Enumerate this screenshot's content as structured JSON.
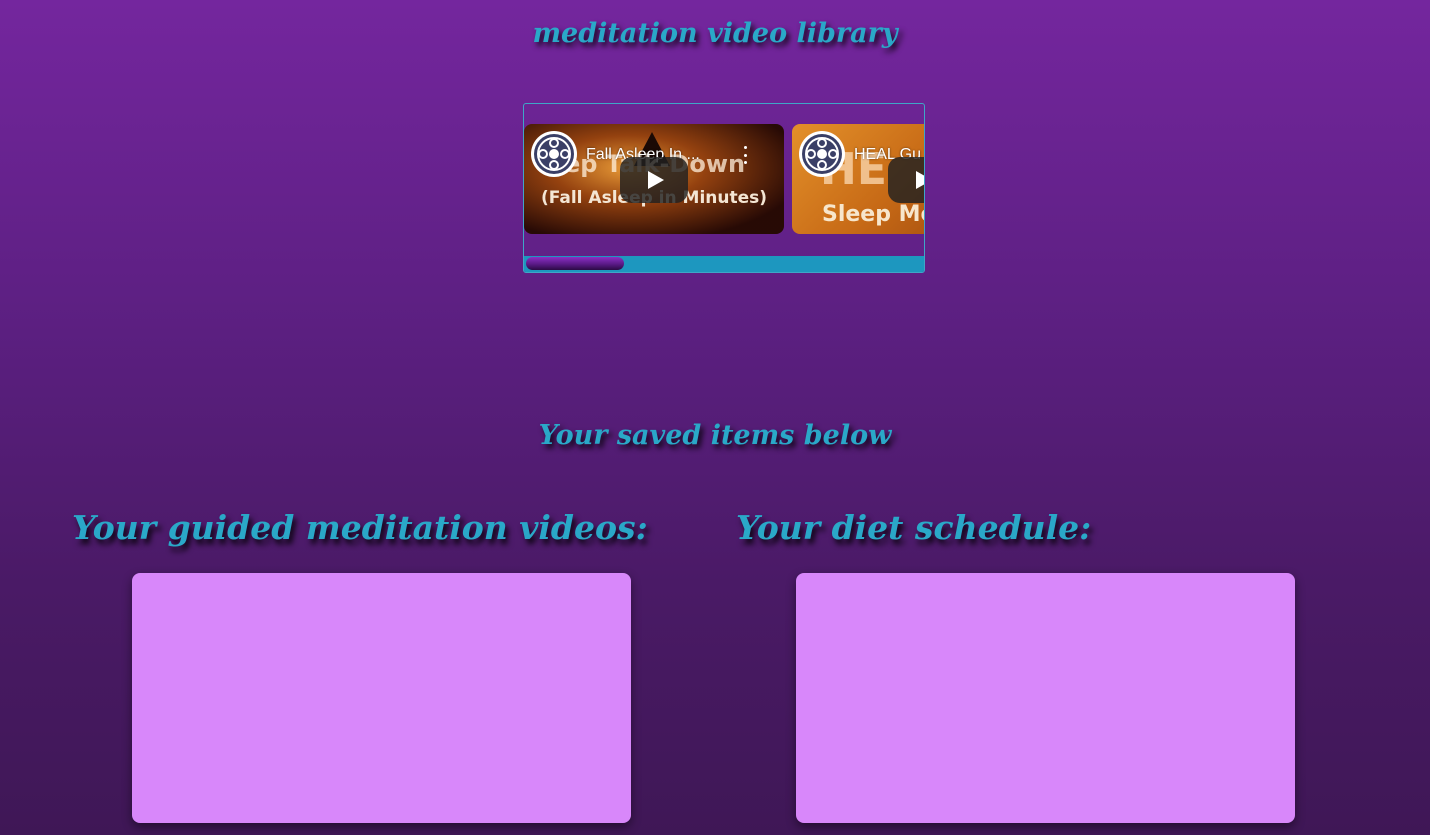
{
  "page": {
    "title": "meditation video library",
    "saved_title": "Your saved items below"
  },
  "carousel": {
    "videos": [
      {
        "title": "Fall Asleep In ...",
        "thumbnail_text": "ep Talk-Down",
        "thumbnail_subtext": "(Fall Asleep in Minutes)"
      },
      {
        "title": "HEAL Gu",
        "thumbnail_text": "HE",
        "thumbnail_subtext": "Sleep Me"
      }
    ]
  },
  "sections": {
    "videos_heading": "Your guided meditation videos:",
    "diet_heading": "Your diet schedule:"
  },
  "colors": {
    "heading": "#2aa8c8",
    "panel": "#d887fa",
    "scrollbar_track": "#1d97bf",
    "background_top": "#74269e",
    "background_bottom": "#3f1756"
  }
}
